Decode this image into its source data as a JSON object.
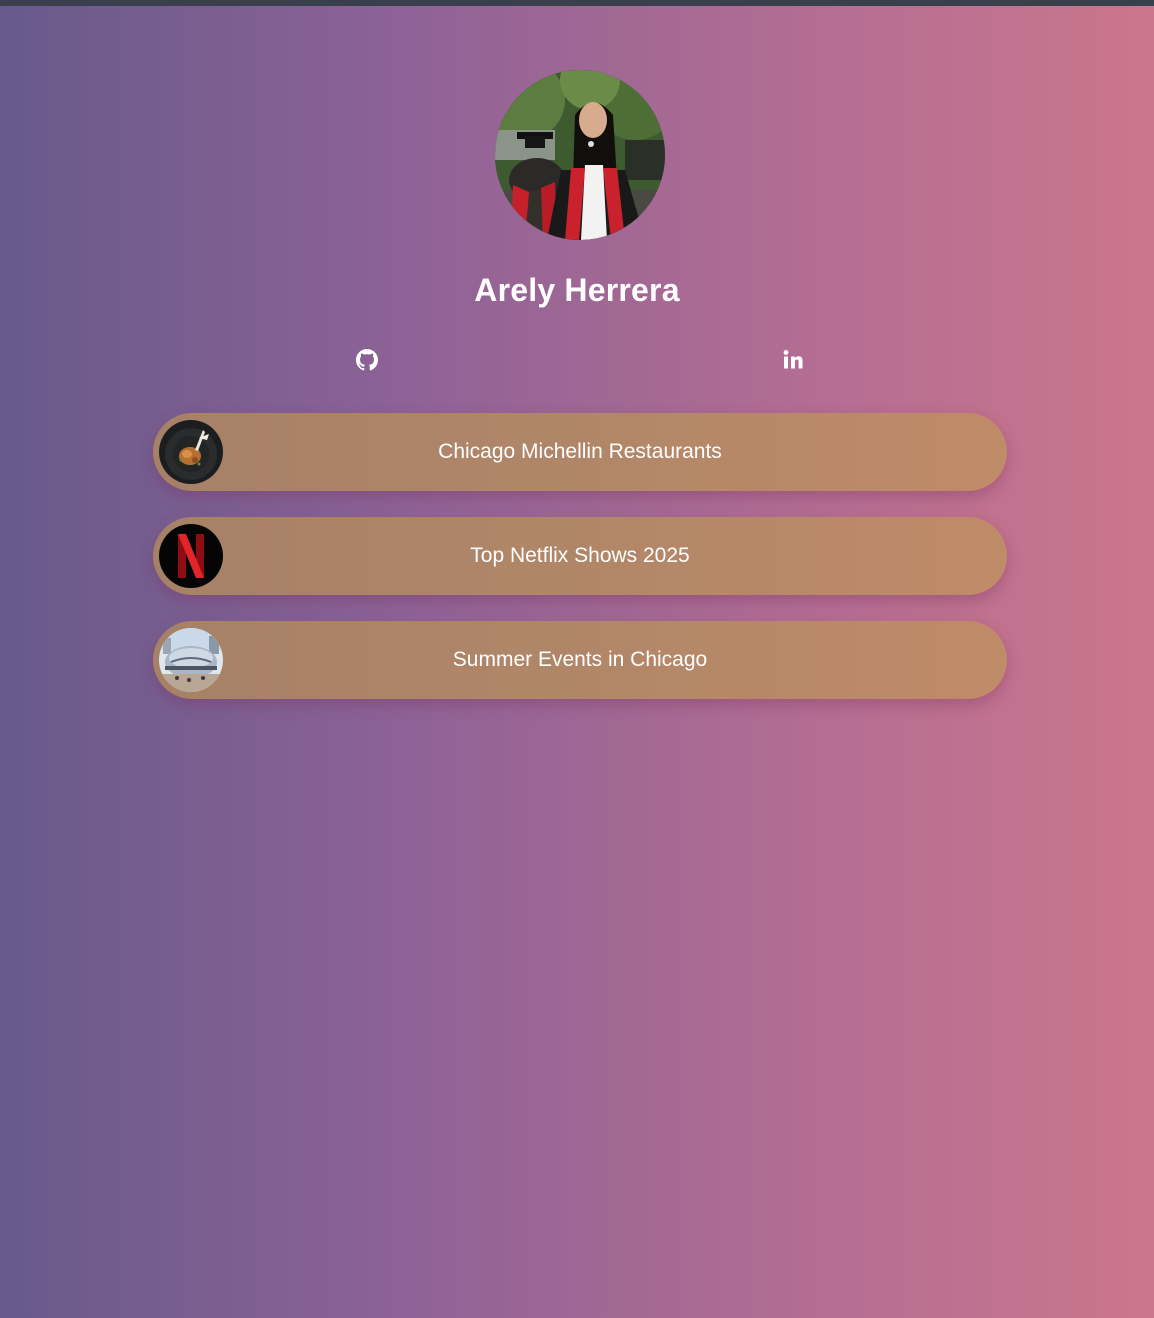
{
  "profile": {
    "name": "Arely Herrera",
    "avatar_icon": "profile-photo"
  },
  "social": [
    {
      "icon": "github-icon"
    },
    {
      "icon": "linkedin-icon"
    }
  ],
  "links": [
    {
      "label": "Chicago Michellin Restaurants",
      "thumb_icon": "food-plate-image"
    },
    {
      "label": "Top Netflix Shows 2025",
      "thumb_icon": "netflix-logo"
    },
    {
      "label": "Summer Events in Chicago",
      "thumb_icon": "chicago-bean-image"
    }
  ],
  "colors": {
    "background_start": "#675a8b",
    "background_end": "#cb768c",
    "card": "#b28768",
    "text": "#ffffff"
  }
}
